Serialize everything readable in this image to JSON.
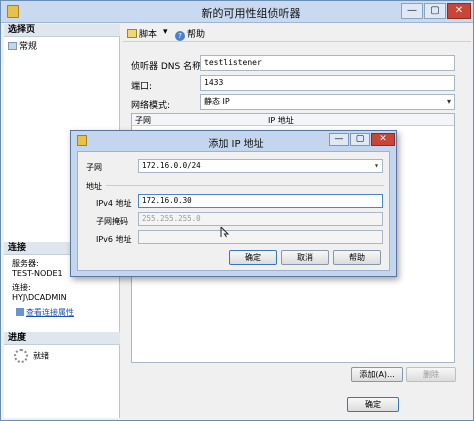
{
  "window": {
    "title": "新的可用性组侦听器",
    "minimize": "—",
    "maximize": "▢",
    "close": "✕"
  },
  "left": {
    "select_page_header": "选择页",
    "pages": [
      "常规"
    ],
    "connection_header": "连接",
    "server_label": "服务器:",
    "server_value": "TEST-NODE1",
    "connection_label": "连接:",
    "connection_value": "HYJ\\DCADMIN",
    "view_conn_props": "查看连接属性",
    "progress_header": "进度",
    "progress_status": "就绪"
  },
  "toolbar": {
    "script": "脚本",
    "script_dropdown": "▾",
    "help": "帮助"
  },
  "form": {
    "dns_label": "侦听器 DNS 名称:",
    "dns_value": "testlistener",
    "port_label": "端口:",
    "port_value": "1433",
    "network_mode_label": "网络模式:",
    "network_mode_value": "静态 IP",
    "grid_columns": [
      "子网",
      "IP 地址"
    ],
    "add_button": "添加(A)...",
    "remove_button": "删除",
    "ok_button": "确定"
  },
  "dialog": {
    "title": "添加 IP 地址",
    "subnet_label": "子网",
    "subnet_value": "172.16.0.0/24",
    "address_group_label": "地址",
    "ipv4_label": "IPv4 地址",
    "ipv4_value": "172.16.0.30",
    "mask_label": "子网掩码",
    "mask_value": "255.255.255.0",
    "ipv6_label": "IPv6 地址",
    "ipv6_value": "",
    "ok_button": "确定",
    "cancel_button": "取消",
    "help_button": "帮助"
  }
}
